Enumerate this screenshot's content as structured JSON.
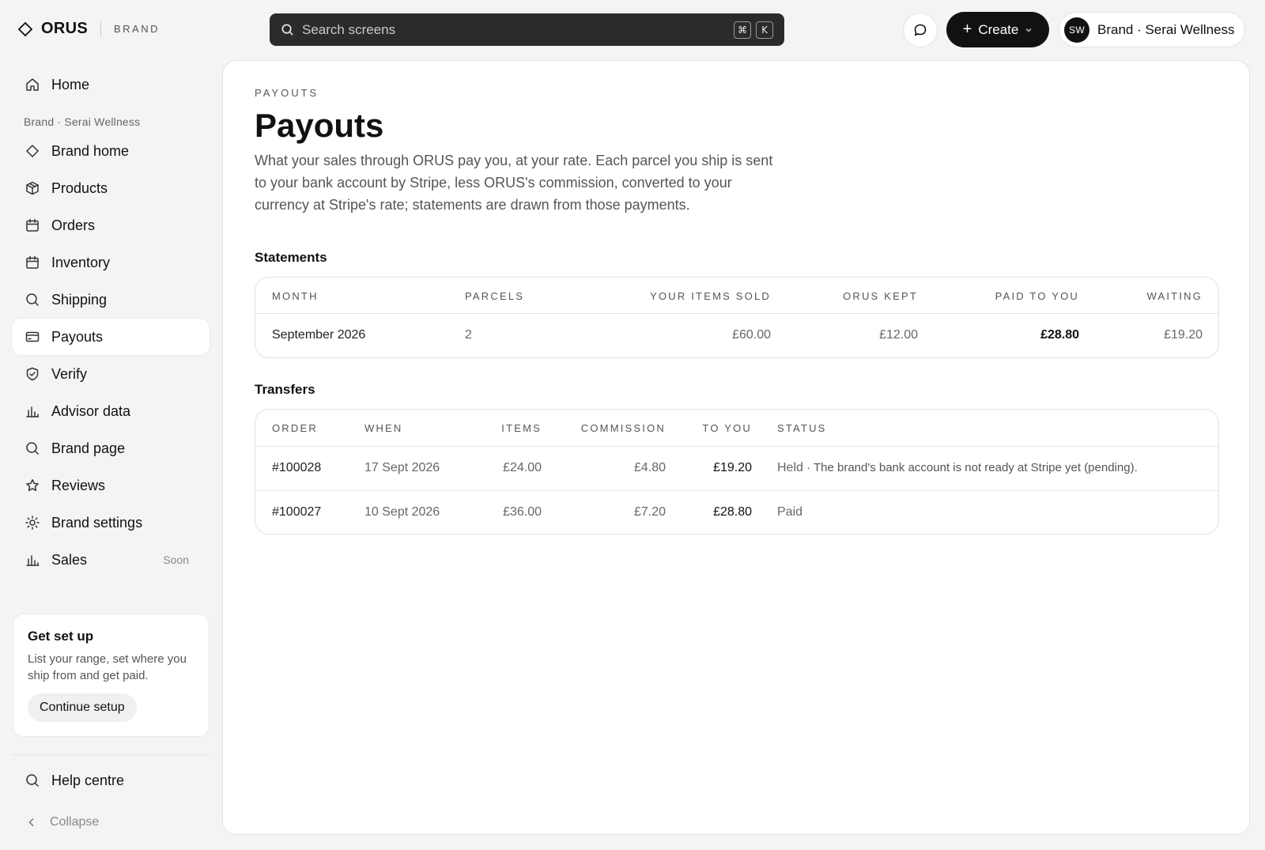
{
  "topbar": {
    "logo": "ORUS",
    "logo_tag": "BRAND",
    "search_placeholder": "Search screens",
    "kbd_cmd": "⌘",
    "kbd_key": "K",
    "create_label": "Create",
    "create_plus": "+",
    "avatar_initials": "SW",
    "account_name": "Brand · Serai Wellness"
  },
  "sidebar": {
    "home_label": "Home",
    "section_label": "Brand · Serai Wellness",
    "items": [
      {
        "label": "Brand home",
        "icon": "diamond-icon"
      },
      {
        "label": "Products",
        "icon": "box-icon"
      },
      {
        "label": "Orders",
        "icon": "calendar-icon"
      },
      {
        "label": "Inventory",
        "icon": "calendar-icon"
      },
      {
        "label": "Shipping",
        "icon": "search-icon"
      },
      {
        "label": "Payouts",
        "icon": "card-icon",
        "active": true
      },
      {
        "label": "Verify",
        "icon": "shield-check-icon"
      },
      {
        "label": "Advisor data",
        "icon": "bar-chart-icon"
      },
      {
        "label": "Brand page",
        "icon": "search-icon"
      },
      {
        "label": "Reviews",
        "icon": "star-icon"
      },
      {
        "label": "Brand settings",
        "icon": "sun-gear-icon"
      },
      {
        "label": "Sales",
        "icon": "bar-chart-icon",
        "badge": "Soon"
      }
    ],
    "setup_card": {
      "title": "Get set up",
      "description": "List your range, set where you ship from and get paid.",
      "cta": "Continue setup"
    },
    "help_label": "Help centre",
    "collapse_label": "Collapse"
  },
  "main": {
    "eyebrow": "PAYOUTS",
    "title": "Payouts",
    "intro": "What your sales through ORUS pay you, at your rate. Each parcel you ship is sent to your bank account by Stripe, less ORUS's commission, converted to your currency at Stripe's rate; statements are drawn from those payments.",
    "statements": {
      "heading": "Statements",
      "columns": [
        "MONTH",
        "PARCELS",
        "YOUR ITEMS SOLD",
        "ORUS KEPT",
        "PAID TO YOU",
        "WAITING"
      ],
      "rows": [
        [
          "September 2026",
          "2",
          "£60.00",
          "£12.00",
          "£28.80",
          "£19.20"
        ]
      ]
    },
    "transfers": {
      "heading": "Transfers",
      "columns": [
        "ORDER",
        "WHEN",
        "ITEMS",
        "COMMISSION",
        "TO YOU",
        "STATUS"
      ],
      "rows": [
        {
          "order": "#100028",
          "when": "17 Sept 2026",
          "items": "£24.00",
          "commission": "£4.80",
          "to_you": "£19.20",
          "status": "Held",
          "status_detail": " · The brand's bank account is not ready at Stripe yet (pending)."
        },
        {
          "order": "#100027",
          "when": "10 Sept 2026",
          "items": "£36.00",
          "commission": "£7.20",
          "to_you": "£28.80",
          "status": "Paid",
          "status_detail": ""
        }
      ]
    }
  },
  "colors": {
    "page_bg": "#f4f4f4",
    "panel_bg": "#ffffff",
    "primary_dark": "#111111",
    "search_bg": "#2b2b2b",
    "muted_text": "#555555"
  }
}
